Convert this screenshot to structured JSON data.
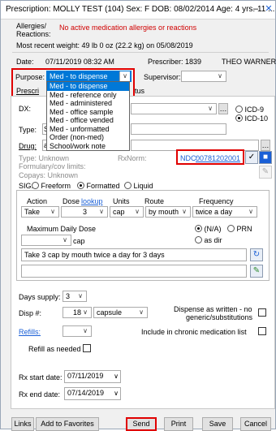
{
  "window": {
    "title": "Prescription: MOLLY TEST (104)  Sex: F  DOB: 08/02/2014  Age: 4 yrs. 11 ...",
    "icons": [
      "minimize-icon",
      "close-icon"
    ]
  },
  "patient": {
    "allergies_label": "Allergies/",
    "reactions_label": "Reactions:",
    "allergies_value": "No active medication allergies or reactions",
    "weight_text": "Most recent weight:  49 lb 0 oz (22.2 kg) on 05/08/2019"
  },
  "header": {
    "date_label": "Date:",
    "date_value": "07/11/2019 08:32 AM",
    "prescriber_label": "Prescriber: 1839",
    "prescriber_name": "THEO WARNER"
  },
  "purpose": {
    "label": "Purpose:",
    "selected": "Med - to dispense",
    "options": [
      "Med - to dispense",
      "Med - reference only",
      "Med - administered",
      "Med - office sample",
      "Med - office vended",
      "Med - unformatted",
      "Order (non-med)",
      "School/work note"
    ]
  },
  "supervisor": {
    "label": "Supervisor:",
    "value": ""
  },
  "tabs": {
    "prescription": "Prescri",
    "status": "tus"
  },
  "dx": {
    "label": "DX:",
    "type_label": "Type:",
    "type_value": "S",
    "icd9": "ICD-9",
    "icd10": "ICD-10"
  },
  "drug": {
    "label": "Drug:",
    "value": "a",
    "type_row": "Type:  Unknown",
    "rxnorm": "RxNorm:",
    "ndc_label": "NDC:",
    "ndc_value": "00781202001"
  },
  "formulary": {
    "limits": "Formulary/cov limits:",
    "copays": "Copays: Unknown"
  },
  "sig": {
    "label": "SIG:",
    "freeform": "Freeform",
    "formatted": "Formatted",
    "liquid": "Liquid",
    "col_action": "Action",
    "col_dose": "Dose",
    "col_lookup": "lookup",
    "col_units": "Units",
    "col_route": "Route",
    "col_frequency": "Frequency",
    "action": "Take",
    "dose": "3",
    "units": "cap",
    "route": "by mouth",
    "frequency": "twice a day",
    "max_dose_label": "Maximum Daily Dose",
    "max_dose_value": "",
    "max_dose_unit": "cap",
    "na": "(N/A)",
    "prn": "PRN",
    "as_dir": "as dir",
    "text": "Take 3 cap by mouth twice a day for 3 days",
    "text2": ""
  },
  "supply": {
    "days_label": "Days supply:",
    "days_value": "3",
    "disp_label": "Disp #:",
    "disp_value": "18",
    "disp_unit": "capsule",
    "daw_line1": "Dispense as written - no",
    "daw_line2": "generic/substitutions",
    "refills_label": "Refills:",
    "refills_value": "",
    "chronic_label": "Include in chronic medication list",
    "refill_needed_label": "Refill as needed"
  },
  "dates": {
    "start_label": "Rx start date:",
    "start_value": "07/11/2019",
    "end_label": "Rx end date:",
    "end_value": "07/14/2019"
  },
  "footer": {
    "links": "Links",
    "favorites": "Add to Favorites",
    "send": "Send",
    "print": "Print",
    "save": "Save",
    "cancel": "Cancel"
  }
}
